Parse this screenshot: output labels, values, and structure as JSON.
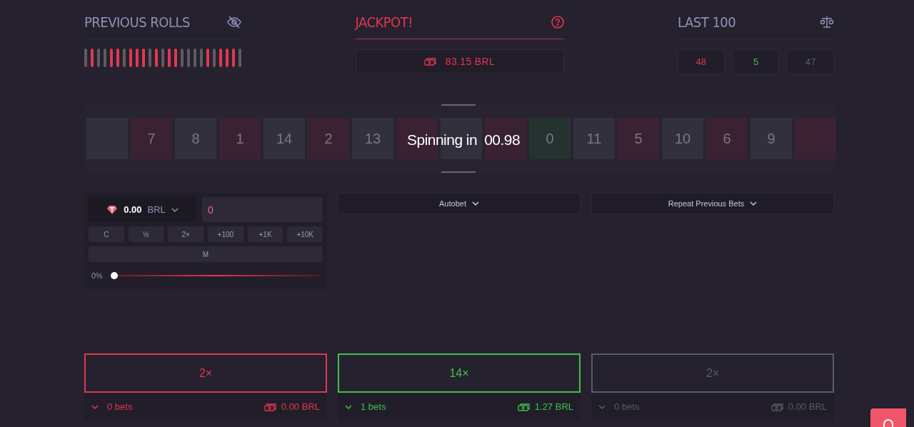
{
  "previous_rolls": {
    "title": "PREVIOUS ROLLS",
    "rolls": [
      {
        "color": "#5e5b62"
      },
      {
        "color": "#e0384f"
      },
      {
        "color": "#5e5b62"
      },
      {
        "color": "#5e5b62"
      },
      {
        "color": "#e0384f"
      },
      {
        "color": "#e0384f"
      },
      {
        "color": "#5e5b62"
      },
      {
        "color": "#e0384f"
      },
      {
        "color": "#e0384f"
      },
      {
        "color": "#e0384f"
      },
      {
        "color": "#5e5b62"
      },
      {
        "color": "#e0384f"
      },
      {
        "color": "#5e5b62"
      },
      {
        "color": "#e0384f"
      },
      {
        "color": "#e0384f"
      },
      {
        "color": "#5e5b62"
      },
      {
        "color": "#5e5b62"
      },
      {
        "color": "#5e5b62"
      },
      {
        "color": "#5e5b62"
      },
      {
        "color": "#e0384f"
      },
      {
        "color": "#5e5b62"
      },
      {
        "color": "#e0384f"
      },
      {
        "color": "#e0384f"
      },
      {
        "color": "#e0384f"
      },
      {
        "color": "#5e5b62"
      }
    ]
  },
  "jackpot": {
    "title": "JACKPOT!",
    "amount": "83.15 BRL"
  },
  "last_100": {
    "title": "LAST 100",
    "counts": [
      {
        "value": "48",
        "color": "#e0384f"
      },
      {
        "value": "5",
        "color": "#3bc24a"
      },
      {
        "value": "47",
        "color": "#5b5b63"
      }
    ]
  },
  "wheel": {
    "status": "Spinning in",
    "timer": "00.98",
    "tiles": [
      {
        "color": "#33303d"
      },
      {
        "color": "#3a2233",
        "label": "7"
      },
      {
        "color": "#33303d",
        "label": "8"
      },
      {
        "color": "#3a2233",
        "label": "1"
      },
      {
        "color": "#33303d",
        "label": "14"
      },
      {
        "color": "#3a2233",
        "label": "2"
      },
      {
        "color": "#33303d",
        "label": "13"
      },
      {
        "color": "#3a2233"
      },
      {
        "color": "#33303d"
      },
      {
        "color": "#3a2233"
      },
      {
        "color": "#253330",
        "label": "0"
      },
      {
        "color": "#33303d",
        "label": "11"
      },
      {
        "color": "#3a2233",
        "label": "5"
      },
      {
        "color": "#33303d",
        "label": "10"
      },
      {
        "color": "#3a2233",
        "label": "6"
      },
      {
        "color": "#33303d",
        "label": "9"
      },
      {
        "color": "#3a2233"
      }
    ]
  },
  "bet": {
    "balance": "0.00",
    "currency": "BRL",
    "amount": "0",
    "buttons": [
      "C",
      "½",
      "2×",
      "+100",
      "+1K",
      "+10K"
    ],
    "max_button": "M",
    "percent": "0%",
    "level": 0
  },
  "autobet": "Autobet",
  "repeat": "Repeat Previous Bets",
  "columns": [
    {
      "multiplier": "2×",
      "bets": "0 bets",
      "amount": "0.00 BRL",
      "color": "#e0384f"
    },
    {
      "multiplier": "14×",
      "bets": "1 bets",
      "amount": "1.27 BRL",
      "color": "#3bc24a"
    },
    {
      "multiplier": "2×",
      "bets": "0 bets",
      "amount": "0.00 BRL",
      "color": "#5b5b63"
    }
  ]
}
